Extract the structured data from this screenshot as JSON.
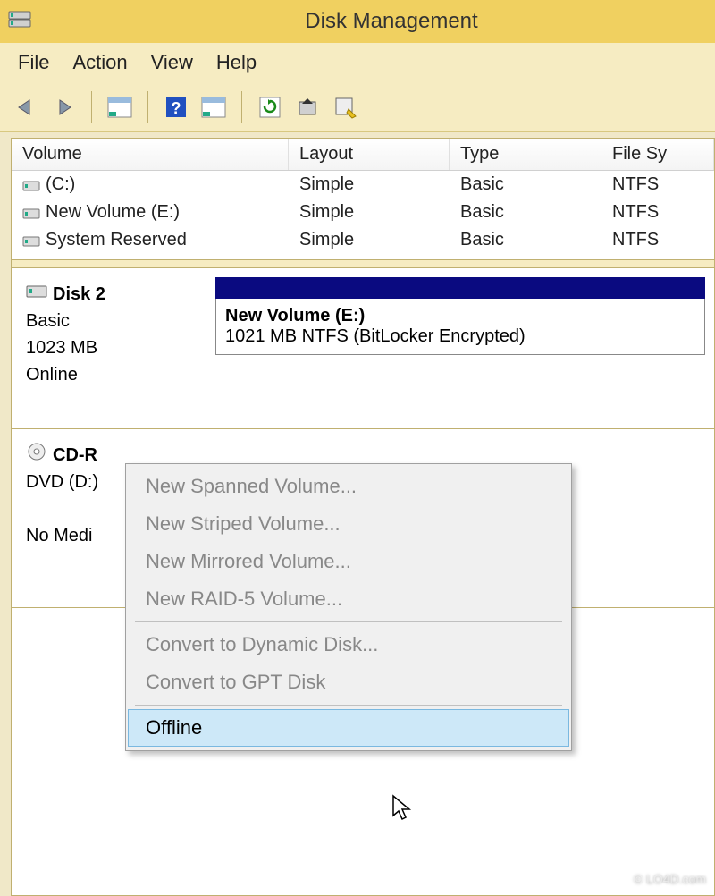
{
  "window": {
    "title": "Disk Management"
  },
  "menu": {
    "file": "File",
    "action": "Action",
    "view": "View",
    "help": "Help"
  },
  "columns": {
    "volume": "Volume",
    "layout": "Layout",
    "type": "Type",
    "fs": "File Sy"
  },
  "volumes": [
    {
      "name": "(C:)",
      "layout": "Simple",
      "type": "Basic",
      "fs": "NTFS"
    },
    {
      "name": "New Volume (E:)",
      "layout": "Simple",
      "type": "Basic",
      "fs": "NTFS"
    },
    {
      "name": "System Reserved",
      "layout": "Simple",
      "type": "Basic",
      "fs": "NTFS"
    }
  ],
  "disks": [
    {
      "name": "Disk 2",
      "type": "Basic",
      "size": "1023 MB",
      "status": "Online",
      "volume_name": "New Volume  (E:)",
      "volume_detail": "1021 MB NTFS (BitLocker Encrypted)"
    },
    {
      "name": "CD-R",
      "type": "DVD (D:)",
      "size": "",
      "status": "No Medi"
    }
  ],
  "context": {
    "items": [
      {
        "label": "New Spanned Volume...",
        "enabled": false
      },
      {
        "label": "New Striped Volume...",
        "enabled": false
      },
      {
        "label": "New Mirrored Volume...",
        "enabled": false
      },
      {
        "label": "New RAID-5 Volume...",
        "enabled": false
      }
    ],
    "items2": [
      {
        "label": "Convert to Dynamic Disk...",
        "enabled": false
      },
      {
        "label": "Convert to GPT Disk",
        "enabled": false
      }
    ],
    "offline": "Offline"
  },
  "watermark": "© LO4D.com"
}
